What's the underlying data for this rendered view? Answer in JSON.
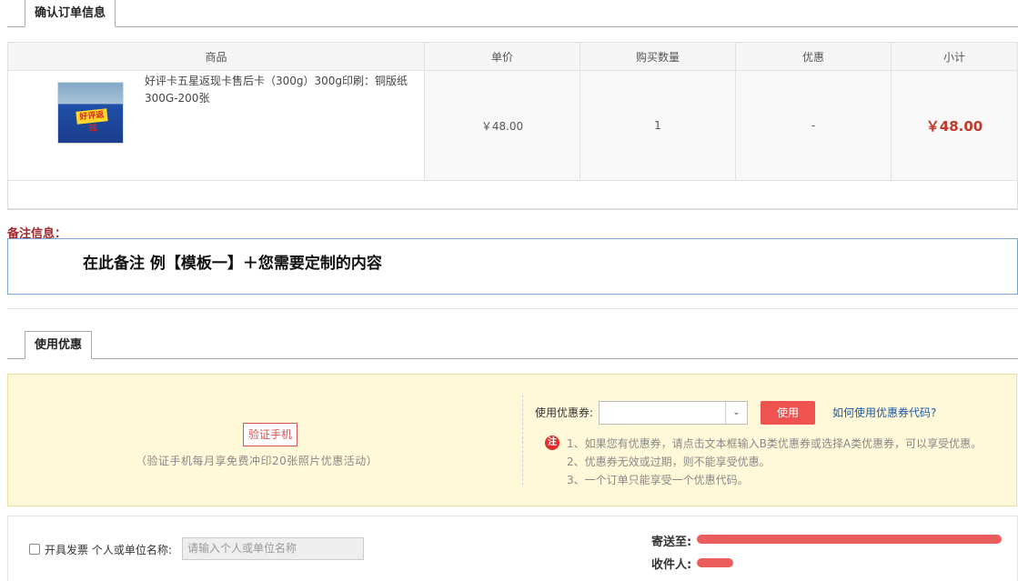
{
  "section_confirm": {
    "title": "确认订单信息"
  },
  "table": {
    "headers": [
      "商品",
      "单价",
      "购买数量",
      "优惠",
      "小计"
    ],
    "row": {
      "name": "好评卡五星返现卡售后卡（300g）300g印刷：铜版纸300G-200张",
      "thumb_text": "好评返现",
      "price": "￥48.00",
      "qty": "1",
      "discount": "-",
      "subtotal": "￥48.00"
    }
  },
  "remark": {
    "label": "备注信息：",
    "value": "在此备注  例【模板一】＋您需要定制的内容"
  },
  "section_coupon": {
    "title": "使用优惠"
  },
  "coupon": {
    "verify_button": "验证手机",
    "verify_desc": "（验证手机每月享免费冲印20张照片优惠活动）",
    "select_label": "使用优惠券:",
    "select_value": "",
    "use_button": "使用",
    "help_link": "如何使用优惠券代码?",
    "note_icon": "注",
    "notes": [
      "1、如果您有优惠券，请点击文本框输入B类优惠券或选择A类优惠券，可以享受优惠。",
      "2、优惠券无效或过期，则不能享受优惠。",
      "3、一个订单只能享受一个优惠代码。"
    ]
  },
  "invoice": {
    "checkbox_label": "开具发票 个人或单位名称:",
    "input_placeholder": "请输入个人或单位名称"
  },
  "shipping": {
    "address_label": "寄送至:",
    "receiver_label": "收件人:"
  },
  "colors": {
    "accent_red": "#ef5350",
    "price_red": "#c0392b",
    "link_blue": "#1a5aa8",
    "coupon_bg": "#fff9d9"
  }
}
